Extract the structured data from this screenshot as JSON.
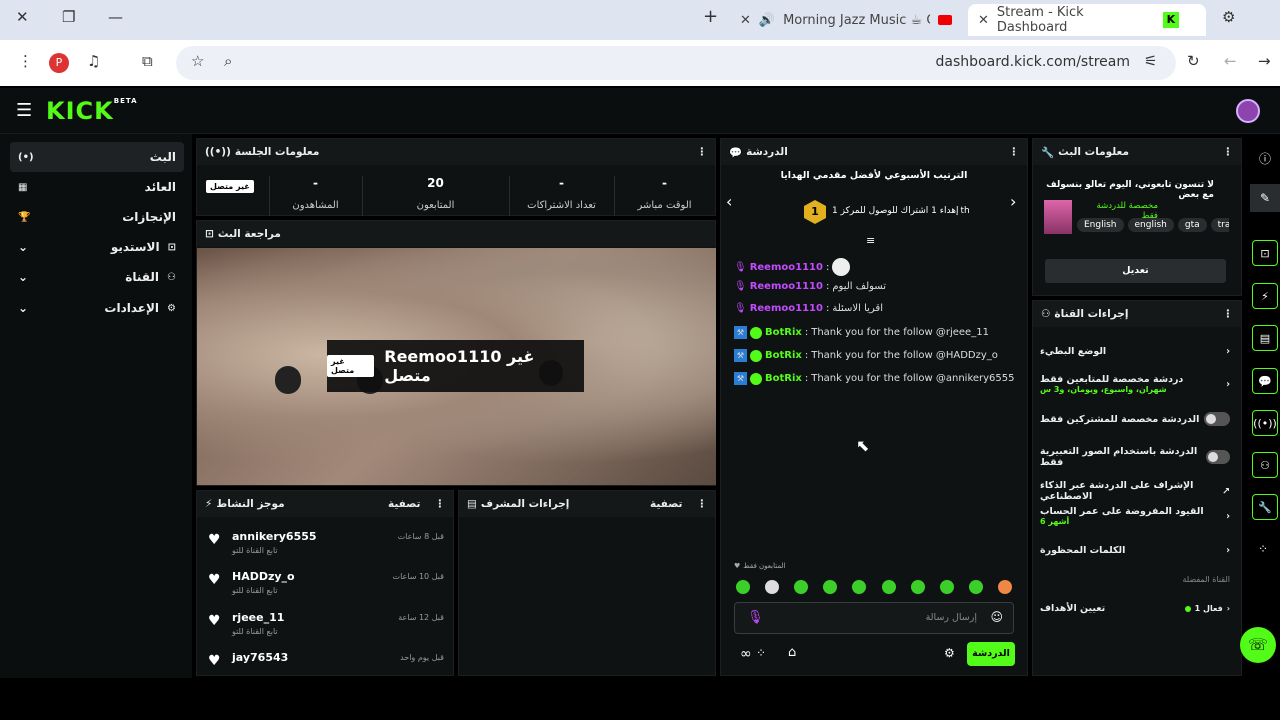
{
  "browser": {
    "tabs": [
      {
        "title": "Morning Jazz Music ☕ Coffee Shop Jazz"
      },
      {
        "title": "Stream - Kick Dashboard"
      }
    ],
    "url": "dashboard.kick.com/stream",
    "profile_initial": "P"
  },
  "brand": {
    "logo": "KICK",
    "beta": "BETA",
    "accent": "#53fc18"
  },
  "sidebar": {
    "items": [
      {
        "label": "البث",
        "icon": "broadcast-icon"
      },
      {
        "label": "العائد",
        "icon": "revenue-icon"
      },
      {
        "label": "الإنجازات",
        "icon": "trophy-icon"
      },
      {
        "label": "الاستديو",
        "icon": "studio-icon"
      },
      {
        "label": "القناة",
        "icon": "channel-icon"
      },
      {
        "label": "الإعدادات",
        "icon": "settings-icon"
      }
    ]
  },
  "session": {
    "title": "معلومات الجلسة",
    "status_badge": "غير متصل",
    "stats": [
      {
        "value": "-",
        "label": "المشاهدون"
      },
      {
        "value": "20",
        "label": "المتابعون"
      },
      {
        "value": "-",
        "label": "تعداد الاشتراكات"
      },
      {
        "value": "-",
        "label": "الوقت مباشر"
      }
    ]
  },
  "preview": {
    "title": "مراجعة البث",
    "overlay_badge": "غير متصل",
    "overlay_text": "Reemoo1110 غير متصل"
  },
  "activity": {
    "title": "موجز النشاط",
    "filter_label": "تصفية",
    "action_text": "تابع القناة للتو",
    "items": [
      {
        "user": "annikery6555",
        "time": "قبل 8 ساعات"
      },
      {
        "user": "HADDzy_o",
        "time": "قبل 10 ساعات"
      },
      {
        "user": "rjeee_11",
        "time": "قبل 12 ساعة"
      },
      {
        "user": "jay76543",
        "time": "قبل يوم واحد"
      }
    ]
  },
  "mod_actions": {
    "title": "إجراءات المشرف",
    "filter_label": "تصفية"
  },
  "chat": {
    "title": "الدردشة",
    "leaderboard_title": "الترتيب الأسبوعي لأفضل مقدمي الهدايا",
    "leaderboard_rank": "1",
    "leaderboard_text": "إهداء 1 اشتراك للوصول للمركز 1",
    "leaderboard_suffix": "th",
    "messages": [
      {
        "user": "Reemoo1110",
        "text": ""
      },
      {
        "user": "Reemoo1110",
        "text": "تسولف اليوم"
      },
      {
        "user": "Reemoo1110",
        "text": "اقريا الاسئلة"
      },
      {
        "user": "BotRix",
        "text": "Thank you for the follow @rjeee_11"
      },
      {
        "user": "BotRix",
        "text": "Thank you for the follow @HADDzy_o"
      },
      {
        "user": "BotRix",
        "text": "Thank you for the follow @annikery6555"
      }
    ],
    "followers_only_label": "المتابعون فقط",
    "input_placeholder": "إرسال رسالة",
    "send_label": "الدردشة"
  },
  "stream_info": {
    "title": "معلومات البث",
    "stream_title": "لا تنسون تابعوني، اليوم تعالو بنسولف مع بعض",
    "category": "مخصصة للدردشة فقط",
    "tags": [
      "English",
      "english",
      "gta",
      "tra"
    ],
    "edit_label": "تعديل"
  },
  "channel_actions": {
    "title": "إجراءات القناة",
    "options": [
      {
        "label": "الوضع البطيء",
        "sub": "",
        "control": "chevron"
      },
      {
        "label": "دردشة مخصصة للمتابعين فقط",
        "sub": "شهران، واسبوع، ويومان، و3 س",
        "control": "chevron"
      },
      {
        "label": "الدردشة مخصصة للمشتركين فقط",
        "sub": "",
        "control": "toggle"
      },
      {
        "label": "الدردشة باستخدام الصور التعبيرية فقط",
        "sub": "",
        "control": "toggle"
      },
      {
        "label": "الإشراف على الدردشة عبر الذكاء الاصطناعي",
        "sub": "",
        "control": "external"
      },
      {
        "label": "القيود المفروضة على عمر الحساب",
        "sub": "أشهر 6",
        "control": "chevron"
      },
      {
        "label": "الكلمات المحظورة",
        "sub": "",
        "control": "chevron"
      }
    ],
    "favorites_label": "القناة المفضلة",
    "goals_label": "تعيين الأهداف",
    "goals_value": "فعال 1"
  }
}
